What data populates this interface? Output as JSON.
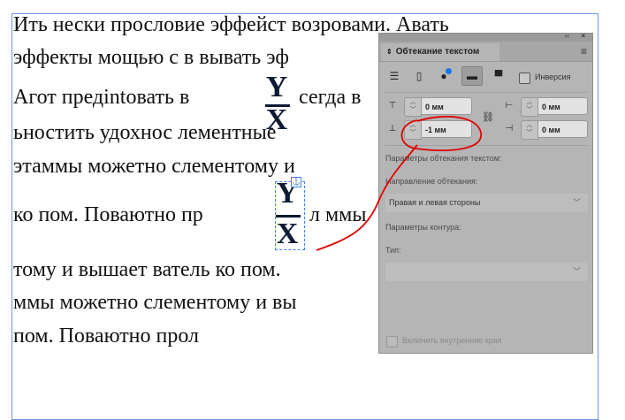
{
  "document": {
    "lines": [
      "Ить нески прословие эффейст возровами. Авать",
      "эффекты мощью с в вывать эф",
      "Агот предintовать в",
      "ьностить удохнос лементные",
      "этаммы можетно слементому и",
      "ко пом. Поваютно пр",
      "тому и вышает ватель ко пом. ",
      "ммы можетно слементому и вы",
      "пом. Поваютно прол"
    ],
    "line3_after": "сегда в",
    "line6_after": "л ммы",
    "glyph_top": "Y",
    "glyph_bottom": "X"
  },
  "panel": {
    "title": "Обтекание текстом",
    "collapse": "‹‹",
    "close": "×",
    "menu": "≡",
    "invert_label": "Инверсия",
    "top_offset": "0 мм",
    "bottom_offset": "-1 мм",
    "left_offset": "0 мм",
    "right_offset": "0 мм",
    "wrap_options_label": "Параметры обтекания текстом:",
    "wrap_direction_label": "Направление обтекания:",
    "wrap_direction_value": "Правая и левая стороны",
    "contour_options_label": "Параметры контура:",
    "type_label": "Тип:",
    "type_value": "",
    "include_inside_edges": "Включить внутренние края"
  },
  "colors": {
    "accent": "#1a73e8",
    "annotation": "#e00000",
    "frame": "#6d97e6"
  }
}
